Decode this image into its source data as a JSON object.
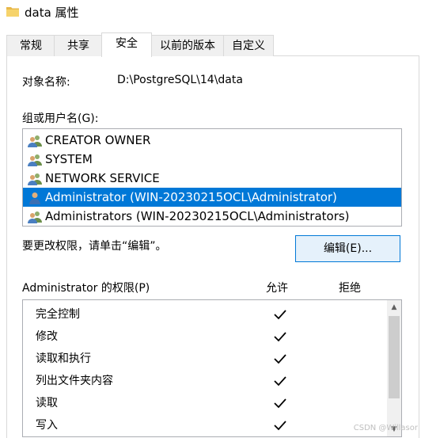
{
  "window": {
    "title": "data 属性"
  },
  "tabs": [
    {
      "label": "常规",
      "active": false
    },
    {
      "label": "共享",
      "active": false
    },
    {
      "label": "安全",
      "active": true
    },
    {
      "label": "以前的版本",
      "active": false
    },
    {
      "label": "自定义",
      "active": false
    }
  ],
  "object": {
    "label": "对象名称:",
    "value": "D:\\PostgreSQL\\14\\data"
  },
  "groups": {
    "label": "组或用户名(G):",
    "items": [
      {
        "name": "CREATOR OWNER",
        "icon": "users-icon",
        "selected": false
      },
      {
        "name": "SYSTEM",
        "icon": "users-icon",
        "selected": false
      },
      {
        "name": "NETWORK SERVICE",
        "icon": "users-icon",
        "selected": false
      },
      {
        "name": "Administrator (WIN-20230215OCL\\Administrator)",
        "icon": "user-icon",
        "selected": true
      },
      {
        "name": "Administrators (WIN-20230215OCL\\Administrators)",
        "icon": "users-icon",
        "selected": false
      }
    ]
  },
  "hint": "要更改权限，请单击“编辑”。",
  "edit_button": "编辑(E)...",
  "permissions": {
    "title": "Administrator 的权限(P)",
    "allow_header": "允许",
    "deny_header": "拒绝",
    "items": [
      {
        "name": "完全控制",
        "allow": true,
        "deny": false
      },
      {
        "name": "修改",
        "allow": true,
        "deny": false
      },
      {
        "name": "读取和执行",
        "allow": true,
        "deny": false
      },
      {
        "name": "列出文件夹内容",
        "allow": true,
        "deny": false
      },
      {
        "name": "读取",
        "allow": true,
        "deny": false
      },
      {
        "name": "写入",
        "allow": true,
        "deny": false
      }
    ]
  },
  "watermark": "CSDN @Willasor"
}
